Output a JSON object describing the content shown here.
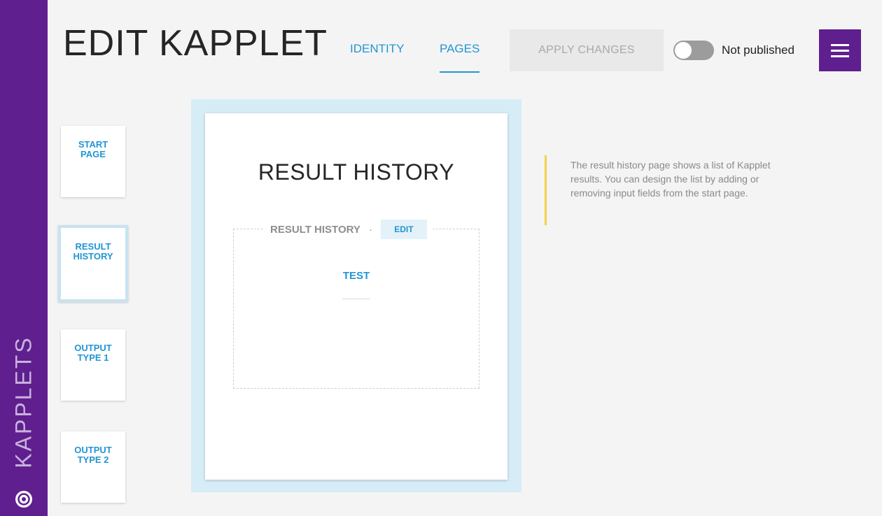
{
  "sidebar": {
    "label": "KAPPLETS"
  },
  "header": {
    "title": "EDIT KAPPLET",
    "tabs": [
      {
        "label": "IDENTITY",
        "active": false
      },
      {
        "label": "PAGES",
        "active": true
      }
    ],
    "apply_label": "APPLY CHANGES",
    "publish_label": "Not published",
    "published": false
  },
  "pages": [
    {
      "line1": "START",
      "line2": "PAGE",
      "active": false
    },
    {
      "line1": "RESULT",
      "line2": "HISTORY",
      "active": true
    },
    {
      "line1": "OUTPUT",
      "line2": "TYPE 1",
      "active": false
    },
    {
      "line1": "OUTPUT",
      "line2": "TYPE 2",
      "active": false
    }
  ],
  "preview": {
    "heading": "RESULT HISTORY",
    "section_title": "RESULT HISTORY",
    "section_separator": "·",
    "edit_label": "EDIT",
    "field_label": "TEST"
  },
  "info": {
    "text": "The result history page shows a list of Kapplet results. You can design the list by adding or removing input fields from the start page."
  },
  "colors": {
    "brand_purple": "#5f1f8f",
    "accent_blue": "#2196d3",
    "info_yellow": "#f1d34c"
  }
}
